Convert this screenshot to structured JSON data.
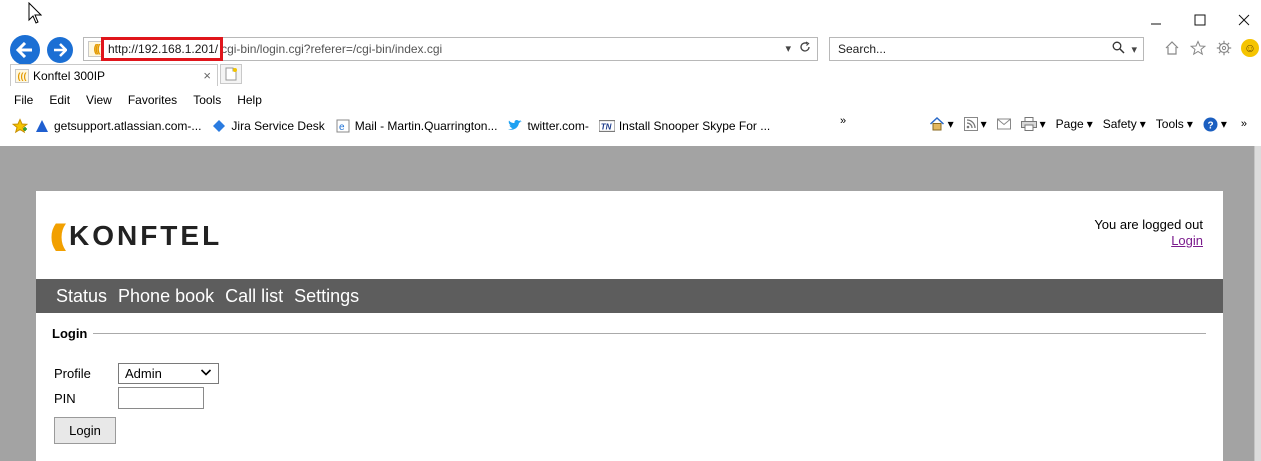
{
  "browser": {
    "address": {
      "host": "http://192.168.1.201/",
      "path": "cgi-bin/login.cgi?referer=/cgi-bin/index.cgi"
    },
    "search": {
      "placeholder": "Search..."
    },
    "tab": {
      "title": "Konftel 300IP"
    },
    "menu": [
      "File",
      "Edit",
      "View",
      "Favorites",
      "Tools",
      "Help"
    ],
    "favorites": [
      {
        "label": "getsupport.atlassian.com-...",
        "icon": "atlassian-icon"
      },
      {
        "label": "Jira Service Desk",
        "icon": "jira-icon"
      },
      {
        "label": "Mail - Martin.Quarrington...",
        "icon": "ie-page-icon"
      },
      {
        "label": "twitter.com-",
        "icon": "twitter-icon"
      },
      {
        "label": "Install Snooper Skype For ...",
        "icon": "tn-icon"
      }
    ],
    "command_bar": {
      "page": "Page",
      "safety": "Safety",
      "tools": "Tools"
    },
    "colors": {
      "nav_button": "#1b6fd4",
      "highlight_box": "#e0151b"
    }
  },
  "page": {
    "brand": "KONFTEL",
    "status_text": "You are logged out",
    "login_link": "Login",
    "nav": [
      "Status",
      "Phone book",
      "Call list",
      "Settings"
    ],
    "form": {
      "legend": "Login",
      "profile_label": "Profile",
      "profile_value": "Admin",
      "pin_label": "PIN",
      "pin_value": "",
      "submit_label": "Login"
    },
    "colors": {
      "navbar": "#5d5d5d",
      "background": "#a3a3a3",
      "logo_accent": "#f2a000",
      "link": "#7a1a8c"
    }
  }
}
